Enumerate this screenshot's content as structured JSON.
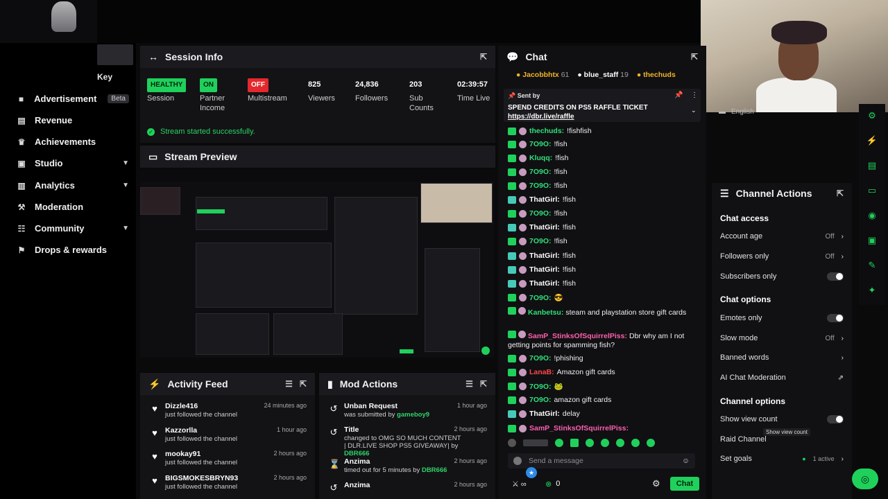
{
  "sidebar": {
    "key_label": "Key",
    "items": [
      {
        "label": "Advertisement",
        "badge": "Beta",
        "icon": "megaphone-icon"
      },
      {
        "label": "Revenue",
        "icon": "money-icon"
      },
      {
        "label": "Achievements",
        "icon": "trophy-icon"
      },
      {
        "label": "Studio",
        "icon": "video-icon"
      },
      {
        "label": "Analytics",
        "icon": "chart-icon"
      },
      {
        "label": "Moderation",
        "icon": "hammer-icon"
      },
      {
        "label": "Community",
        "icon": "users-icon"
      },
      {
        "label": "Drops & rewards",
        "icon": "gift-icon"
      }
    ]
  },
  "session": {
    "title": "Session Info",
    "stats": [
      {
        "value": "HEALTHY",
        "label": "Session",
        "style": "green"
      },
      {
        "value": "ON",
        "label": "Partner Income",
        "style": "green"
      },
      {
        "value": "OFF",
        "label": "Multistream",
        "style": "red"
      },
      {
        "value": "825",
        "label": "Viewers"
      },
      {
        "value": "24,836",
        "label": "Followers"
      },
      {
        "value": "203",
        "label": "Sub Counts"
      },
      {
        "value": "02:39:57",
        "label": "Time Live"
      }
    ],
    "status": "Stream started successfully."
  },
  "preview": {
    "title": "Stream Preview"
  },
  "activity": {
    "title": "Activity Feed",
    "items": [
      {
        "name": "Dizzle416",
        "sub": "just followed the channel",
        "time": "24 minutes ago"
      },
      {
        "name": "Kazzorlla",
        "sub": "just followed the channel",
        "time": "1 hour ago"
      },
      {
        "name": "mookay91",
        "sub": "just followed the channel",
        "time": "2 hours ago"
      },
      {
        "name": "BIGSMOKESBRYN93",
        "sub": "just followed the channel",
        "time": "2 hours ago"
      }
    ]
  },
  "mod": {
    "title": "Mod Actions",
    "items": [
      {
        "name": "Unban Request",
        "sub": "was submitted by ",
        "actor": "gameboy9",
        "time": "1 hour ago"
      },
      {
        "name": "Title",
        "sub": "changed to OMG SO MUCH CONTENT | DLR.LIVE SHOP PS5 GIVEAWAY| by ",
        "actor": "DBR666",
        "time": "2 hours ago"
      },
      {
        "name": "Anzima",
        "sub": "timed out for 5 minutes by ",
        "actor": "DBR666",
        "time": "2 hours ago"
      },
      {
        "name": "Anzima",
        "sub": "",
        "actor": "",
        "time": "2 hours ago"
      }
    ]
  },
  "chat": {
    "title": "Chat",
    "top_users": [
      {
        "name": "Jacobbhtx",
        "count": "61"
      },
      {
        "name": "blue_staff",
        "count": "19"
      },
      {
        "name": "thechuds",
        "count": ""
      }
    ],
    "pinned_sender": "Sent by",
    "pinned_text": "SPEND CREDITS ON PS5 RAFFLE TICKET",
    "pinned_link": "https://dbr.live/raffle",
    "lines": [
      {
        "user": "thechuds:",
        "text": "!fishfish",
        "color": "green"
      },
      {
        "user": "7O9O:",
        "text": "!fish",
        "color": "green"
      },
      {
        "user": "Kluqq:",
        "text": "!fish",
        "color": "green"
      },
      {
        "user": "7O9O:",
        "text": "!fish",
        "color": "green"
      },
      {
        "user": "7O9O:",
        "text": "!fish",
        "color": "green"
      },
      {
        "user": "ThatGirl:",
        "text": "!fish",
        "color": "white"
      },
      {
        "user": "7O9O:",
        "text": "!fish",
        "color": "green"
      },
      {
        "user": "ThatGirl:",
        "text": "!fish",
        "color": "white"
      },
      {
        "user": "7O9O:",
        "text": "!fish",
        "color": "green"
      },
      {
        "user": "ThatGirl:",
        "text": "!fish",
        "color": "white"
      },
      {
        "user": "ThatGirl:",
        "text": "!fish",
        "color": "white"
      },
      {
        "user": "ThatGirl:",
        "text": "!fish",
        "color": "white"
      },
      {
        "user": "7O9O:",
        "text": "😎",
        "color": "green"
      },
      {
        "user": "Kanbetsu:",
        "text": "steam and playstation store gift cards",
        "color": "green"
      },
      {
        "user": "SamP_StinksOfSquirrelPiss:",
        "text": "Dbr why am I not getting points for spamming fish?",
        "color": "pink"
      },
      {
        "user": "7O9O:",
        "text": "!phishing",
        "color": "green"
      },
      {
        "user": "LanaB:",
        "text": "Amazon gift cards",
        "color": "red"
      },
      {
        "user": "7O9O:",
        "text": "🐸",
        "color": "green"
      },
      {
        "user": "7O9O:",
        "text": "amazon gift cards",
        "color": "green"
      },
      {
        "user": "ThatGirl:",
        "text": "delay",
        "color": "white"
      },
      {
        "user": "SamP_StinksOfSquirrelPiss:",
        "text": "",
        "color": "pink"
      }
    ],
    "input_placeholder": "Send a message",
    "points": "0",
    "send_label": "Chat"
  },
  "webcam": {
    "language": "English"
  },
  "channel_actions": {
    "title": "Channel Actions",
    "sections": [
      {
        "title": "Chat access",
        "rows": [
          {
            "label": "Account age",
            "value": "Off",
            "type": "chevron"
          },
          {
            "label": "Followers only",
            "value": "Off",
            "type": "chevron"
          },
          {
            "label": "Subscribers only",
            "value": "",
            "type": "toggle"
          }
        ]
      },
      {
        "title": "Chat options",
        "rows": [
          {
            "label": "Emotes only",
            "value": "",
            "type": "toggle"
          },
          {
            "label": "Slow mode",
            "value": "Off",
            "type": "chevron"
          },
          {
            "label": "Banned words",
            "value": "",
            "type": "chevron"
          },
          {
            "label": "AI Chat Moderation",
            "value": "",
            "type": "external"
          }
        ]
      },
      {
        "title": "Channel options",
        "rows": [
          {
            "label": "Show view count",
            "value": "",
            "type": "toggle"
          },
          {
            "label": "Raid Channel",
            "value": "",
            "type": "none"
          },
          {
            "label": "Set goals",
            "value": "1 active",
            "type": "chevron"
          }
        ]
      }
    ],
    "tooltip": "Show view count"
  }
}
